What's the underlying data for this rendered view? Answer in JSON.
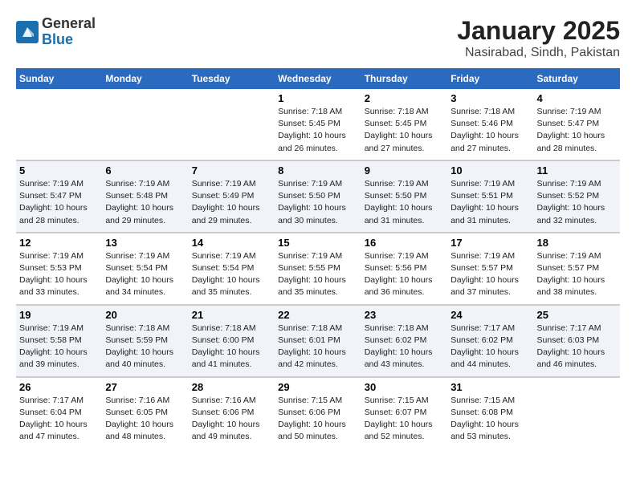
{
  "header": {
    "logo_general": "General",
    "logo_blue": "Blue",
    "title": "January 2025",
    "subtitle": "Nasirabad, Sindh, Pakistan"
  },
  "days_of_week": [
    "Sunday",
    "Monday",
    "Tuesday",
    "Wednesday",
    "Thursday",
    "Friday",
    "Saturday"
  ],
  "weeks": [
    [
      {
        "day": "",
        "info": ""
      },
      {
        "day": "",
        "info": ""
      },
      {
        "day": "",
        "info": ""
      },
      {
        "day": "1",
        "info": "Sunrise: 7:18 AM\nSunset: 5:45 PM\nDaylight: 10 hours\nand 26 minutes."
      },
      {
        "day": "2",
        "info": "Sunrise: 7:18 AM\nSunset: 5:45 PM\nDaylight: 10 hours\nand 27 minutes."
      },
      {
        "day": "3",
        "info": "Sunrise: 7:18 AM\nSunset: 5:46 PM\nDaylight: 10 hours\nand 27 minutes."
      },
      {
        "day": "4",
        "info": "Sunrise: 7:19 AM\nSunset: 5:47 PM\nDaylight: 10 hours\nand 28 minutes."
      }
    ],
    [
      {
        "day": "5",
        "info": "Sunrise: 7:19 AM\nSunset: 5:47 PM\nDaylight: 10 hours\nand 28 minutes."
      },
      {
        "day": "6",
        "info": "Sunrise: 7:19 AM\nSunset: 5:48 PM\nDaylight: 10 hours\nand 29 minutes."
      },
      {
        "day": "7",
        "info": "Sunrise: 7:19 AM\nSunset: 5:49 PM\nDaylight: 10 hours\nand 29 minutes."
      },
      {
        "day": "8",
        "info": "Sunrise: 7:19 AM\nSunset: 5:50 PM\nDaylight: 10 hours\nand 30 minutes."
      },
      {
        "day": "9",
        "info": "Sunrise: 7:19 AM\nSunset: 5:50 PM\nDaylight: 10 hours\nand 31 minutes."
      },
      {
        "day": "10",
        "info": "Sunrise: 7:19 AM\nSunset: 5:51 PM\nDaylight: 10 hours\nand 31 minutes."
      },
      {
        "day": "11",
        "info": "Sunrise: 7:19 AM\nSunset: 5:52 PM\nDaylight: 10 hours\nand 32 minutes."
      }
    ],
    [
      {
        "day": "12",
        "info": "Sunrise: 7:19 AM\nSunset: 5:53 PM\nDaylight: 10 hours\nand 33 minutes."
      },
      {
        "day": "13",
        "info": "Sunrise: 7:19 AM\nSunset: 5:54 PM\nDaylight: 10 hours\nand 34 minutes."
      },
      {
        "day": "14",
        "info": "Sunrise: 7:19 AM\nSunset: 5:54 PM\nDaylight: 10 hours\nand 35 minutes."
      },
      {
        "day": "15",
        "info": "Sunrise: 7:19 AM\nSunset: 5:55 PM\nDaylight: 10 hours\nand 35 minutes."
      },
      {
        "day": "16",
        "info": "Sunrise: 7:19 AM\nSunset: 5:56 PM\nDaylight: 10 hours\nand 36 minutes."
      },
      {
        "day": "17",
        "info": "Sunrise: 7:19 AM\nSunset: 5:57 PM\nDaylight: 10 hours\nand 37 minutes."
      },
      {
        "day": "18",
        "info": "Sunrise: 7:19 AM\nSunset: 5:57 PM\nDaylight: 10 hours\nand 38 minutes."
      }
    ],
    [
      {
        "day": "19",
        "info": "Sunrise: 7:19 AM\nSunset: 5:58 PM\nDaylight: 10 hours\nand 39 minutes."
      },
      {
        "day": "20",
        "info": "Sunrise: 7:18 AM\nSunset: 5:59 PM\nDaylight: 10 hours\nand 40 minutes."
      },
      {
        "day": "21",
        "info": "Sunrise: 7:18 AM\nSunset: 6:00 PM\nDaylight: 10 hours\nand 41 minutes."
      },
      {
        "day": "22",
        "info": "Sunrise: 7:18 AM\nSunset: 6:01 PM\nDaylight: 10 hours\nand 42 minutes."
      },
      {
        "day": "23",
        "info": "Sunrise: 7:18 AM\nSunset: 6:02 PM\nDaylight: 10 hours\nand 43 minutes."
      },
      {
        "day": "24",
        "info": "Sunrise: 7:17 AM\nSunset: 6:02 PM\nDaylight: 10 hours\nand 44 minutes."
      },
      {
        "day": "25",
        "info": "Sunrise: 7:17 AM\nSunset: 6:03 PM\nDaylight: 10 hours\nand 46 minutes."
      }
    ],
    [
      {
        "day": "26",
        "info": "Sunrise: 7:17 AM\nSunset: 6:04 PM\nDaylight: 10 hours\nand 47 minutes."
      },
      {
        "day": "27",
        "info": "Sunrise: 7:16 AM\nSunset: 6:05 PM\nDaylight: 10 hours\nand 48 minutes."
      },
      {
        "day": "28",
        "info": "Sunrise: 7:16 AM\nSunset: 6:06 PM\nDaylight: 10 hours\nand 49 minutes."
      },
      {
        "day": "29",
        "info": "Sunrise: 7:15 AM\nSunset: 6:06 PM\nDaylight: 10 hours\nand 50 minutes."
      },
      {
        "day": "30",
        "info": "Sunrise: 7:15 AM\nSunset: 6:07 PM\nDaylight: 10 hours\nand 52 minutes."
      },
      {
        "day": "31",
        "info": "Sunrise: 7:15 AM\nSunset: 6:08 PM\nDaylight: 10 hours\nand 53 minutes."
      },
      {
        "day": "",
        "info": ""
      }
    ]
  ]
}
